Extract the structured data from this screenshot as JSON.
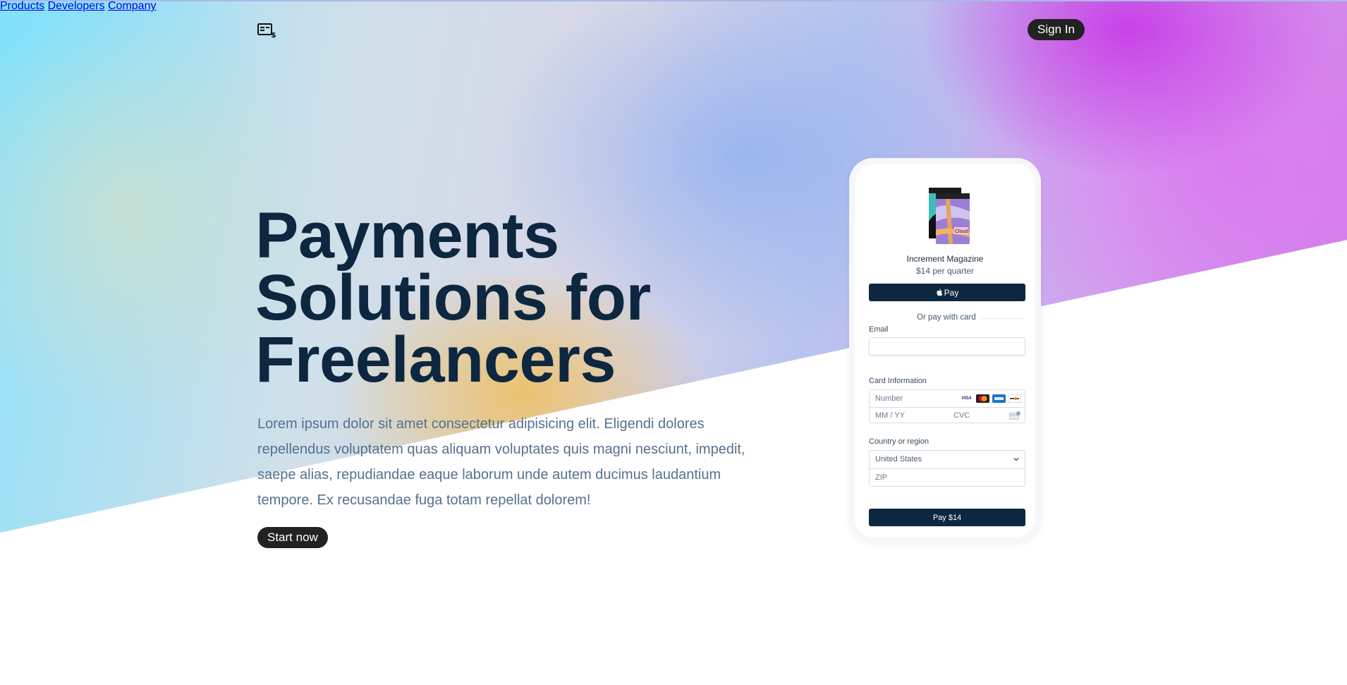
{
  "nav": {
    "items": [
      {
        "label": "Products"
      },
      {
        "label": "Developers"
      },
      {
        "label": "Company"
      }
    ],
    "sign_in": "Sign In",
    "logo_icon": "receipt-dollar-icon"
  },
  "hero": {
    "title_lines": [
      "Payments",
      "Solutions for",
      "Freelancers"
    ],
    "description": "Lorem ipsum dolor sit amet consectetur adipisicing elit. Eligendi dolores repellendus voluptatem quas aliquam voluptates quis magni nesciunt, impedit, saepe alias, repudiandae eaque laborum unde autem ducimus laudantium tempore. Ex recusandae fuga totam repellat dolorem!",
    "cta": "Start now"
  },
  "checkout": {
    "product_name": "Increment Magazine",
    "product_price": "$14 per quarter",
    "product_image_text": "Cloud",
    "apple_pay_label": "Pay",
    "divider_label": "Or pay with card",
    "email_label": "Email",
    "email_value": "",
    "card_label": "Card Information",
    "card_number_placeholder": "Number",
    "card_exp_placeholder": "MM / YY",
    "card_cvc_placeholder": "CVC",
    "card_brands": [
      "VISA",
      "mastercard",
      "amex",
      "discover"
    ],
    "country_label": "Country or region",
    "country_value": "United States",
    "zip_placeholder": "ZIP",
    "pay_button": "Pay $14"
  },
  "colors": {
    "navy": "#0d2740",
    "button_dark": "#222222",
    "body_text": "#55718f"
  }
}
